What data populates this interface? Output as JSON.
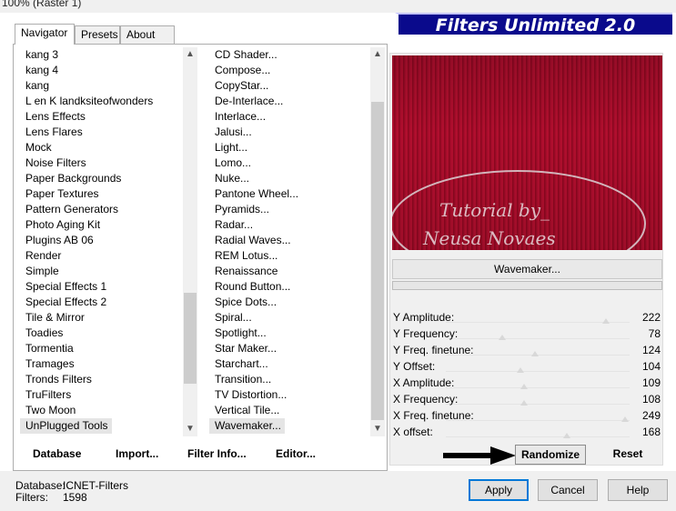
{
  "window": {
    "title": "100% (Raster 1)"
  },
  "brand": "Filters Unlimited 2.0",
  "tabs": [
    {
      "label": "Navigator"
    },
    {
      "label": "Presets"
    },
    {
      "label": "About"
    }
  ],
  "categories": [
    "kang 3",
    "kang 4",
    "kang",
    "L en K landksiteofwonders",
    "Lens Effects",
    "Lens Flares",
    "Mock",
    "Noise Filters",
    "Paper Backgrounds",
    "Paper Textures",
    "Pattern Generators",
    "Photo Aging Kit",
    "Plugins AB 06",
    "Render",
    "Simple",
    "Special Effects 1",
    "Special Effects 2",
    "Tile & Mirror",
    "Toadies",
    "Tormentia",
    "Tramages",
    "Tronds Filters",
    "TruFilters",
    "Two Moon",
    "UnPlugged Tools"
  ],
  "selected_category": "UnPlugged Tools",
  "filters": [
    "CD Shader...",
    "Compose...",
    "CopyStar...",
    "De-Interlace...",
    "Interlace...",
    "Jalusi...",
    "Light...",
    "Lomo...",
    "Nuke...",
    "Pantone Wheel...",
    "Pyramids...",
    "Radar...",
    "Radial Waves...",
    "REM Lotus...",
    "Renaissance",
    "Round Button...",
    "Spice Dots...",
    "Spiral...",
    "Spotlight...",
    "Star Maker...",
    "Starchart...",
    "Transition...",
    "TV Distortion...",
    "Vertical Tile...",
    "Wavemaker..."
  ],
  "selected_filter": "Wavemaker...",
  "bottom_buttons": {
    "database": "Database",
    "import": "Import...",
    "filter_info": "Filter Info...",
    "editor": "Editor..."
  },
  "watermark": {
    "line1": "Tutorial by_",
    "line2": "Neusa Novaes"
  },
  "filter_name": "Wavemaker...",
  "params": [
    {
      "label": "Y Amplitude:",
      "value": "222"
    },
    {
      "label": "Y Frequency:",
      "value": "78"
    },
    {
      "label": "Y Freq. finetune:",
      "value": "124"
    },
    {
      "label": "Y Offset:",
      "value": "104"
    },
    {
      "label": "X Amplitude:",
      "value": "109"
    },
    {
      "label": "X Frequency:",
      "value": "108"
    },
    {
      "label": "X Freq. finetune:",
      "value": "249"
    },
    {
      "label": "X offset:",
      "value": "168"
    }
  ],
  "randomize": "Randomize",
  "reset": "Reset",
  "database_info": {
    "db_label": "Database:",
    "db_value": "ICNET-Filters",
    "filters_label": "Filters:",
    "filters_value": "1598"
  },
  "dialog_buttons": {
    "apply": "Apply",
    "cancel": "Cancel",
    "help": "Help"
  },
  "colors": {
    "brand_bg": "#0a0a8c",
    "preview_red": "#b10f2e",
    "apply_border": "#0078d7"
  }
}
